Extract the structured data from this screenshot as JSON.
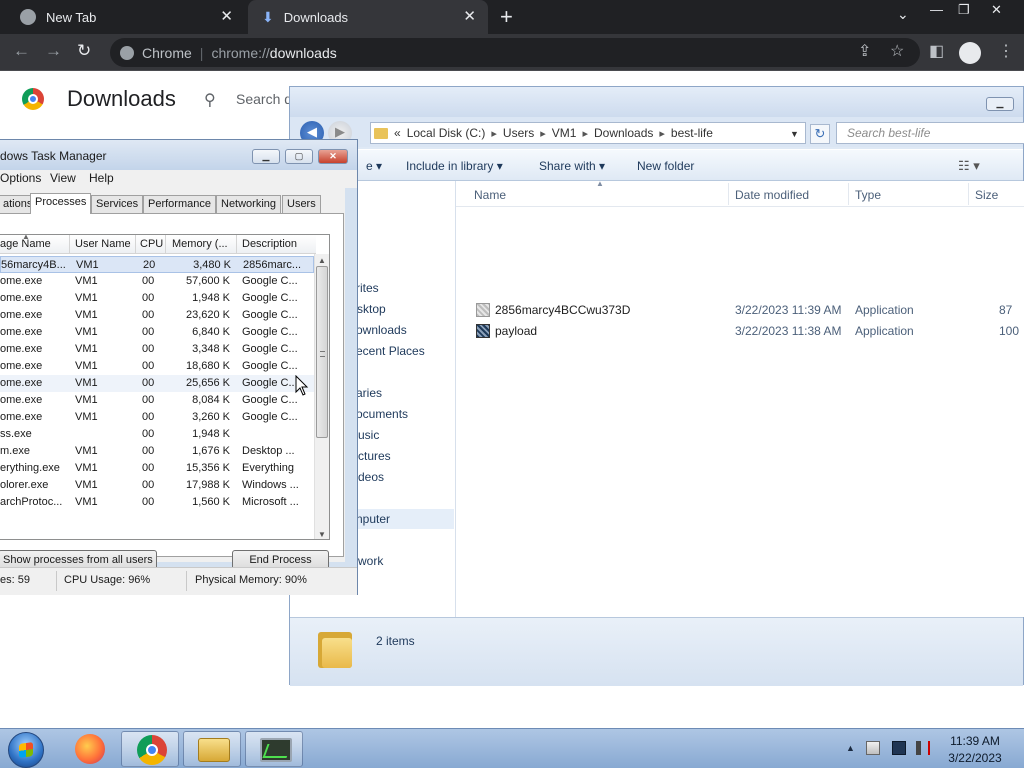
{
  "chrome": {
    "tabs": [
      {
        "title": "New Tab"
      },
      {
        "title": "Downloads"
      }
    ],
    "omnibox": {
      "chip": "Chrome",
      "url_scheme": "chrome://",
      "url_host": "downloads"
    },
    "page": {
      "title": "Downloads",
      "search_placeholder": "Search d"
    }
  },
  "explorer": {
    "address": {
      "prefix": "«",
      "crumbs": [
        "Local Disk (C:)",
        "Users",
        "VM1",
        "Downloads",
        "best-life"
      ]
    },
    "search_placeholder": "Search best-life",
    "commands": {
      "organize_tail": "e",
      "include_in_library": "Include in library",
      "share_with": "Share with",
      "new_folder": "New folder"
    },
    "nav": [
      {
        "label": "rites"
      },
      {
        "label": "sktop"
      },
      {
        "label": "ownloads"
      },
      {
        "label": "ecent Places"
      },
      {
        "label": "aries"
      },
      {
        "label": "ocuments"
      },
      {
        "label": "usic"
      },
      {
        "label": "ctures"
      },
      {
        "label": "deos"
      },
      {
        "label": "nputer"
      },
      {
        "label": "work"
      }
    ],
    "columns": {
      "name": "Name",
      "date_modified": "Date modified",
      "type": "Type",
      "size": "Size"
    },
    "files": [
      {
        "name": "2856marcy4BCCwu373D",
        "date": "3/22/2023 11:39 AM",
        "type": "Application",
        "size": "87"
      },
      {
        "name": "payload",
        "date": "3/22/2023 11:38 AM",
        "type": "Application",
        "size": "100"
      }
    ],
    "details": {
      "item_count": "2 items"
    }
  },
  "task_manager": {
    "title": "dows Task Manager",
    "menu": [
      "Options",
      "View",
      "Help"
    ],
    "tabs": [
      "ations",
      "Processes",
      "Services",
      "Performance",
      "Networking",
      "Users"
    ],
    "active_tab": "Processes",
    "columns": {
      "image_name": "age Name",
      "user_name": "User Name",
      "cpu": "CPU",
      "memory": "Memory (...",
      "description": "Description"
    },
    "processes": [
      {
        "name": "56marcy4B...",
        "user": "VM1",
        "cpu": "20",
        "mem": "3,480 K",
        "desc": "2856marc..."
      },
      {
        "name": "ome.exe",
        "user": "VM1",
        "cpu": "00",
        "mem": "57,600 K",
        "desc": "Google C..."
      },
      {
        "name": "ome.exe",
        "user": "VM1",
        "cpu": "00",
        "mem": "1,948 K",
        "desc": "Google C..."
      },
      {
        "name": "ome.exe",
        "user": "VM1",
        "cpu": "00",
        "mem": "23,620 K",
        "desc": "Google C..."
      },
      {
        "name": "ome.exe",
        "user": "VM1",
        "cpu": "00",
        "mem": "6,840 K",
        "desc": "Google C..."
      },
      {
        "name": "ome.exe",
        "user": "VM1",
        "cpu": "00",
        "mem": "3,348 K",
        "desc": "Google C..."
      },
      {
        "name": "ome.exe",
        "user": "VM1",
        "cpu": "00",
        "mem": "18,680 K",
        "desc": "Google C..."
      },
      {
        "name": "ome.exe",
        "user": "VM1",
        "cpu": "00",
        "mem": "25,656 K",
        "desc": "Google C..."
      },
      {
        "name": "ome.exe",
        "user": "VM1",
        "cpu": "00",
        "mem": "8,084 K",
        "desc": "Google C..."
      },
      {
        "name": "ome.exe",
        "user": "VM1",
        "cpu": "00",
        "mem": "3,260 K",
        "desc": "Google C..."
      },
      {
        "name": "ss.exe",
        "user": "",
        "cpu": "00",
        "mem": "1,948 K",
        "desc": ""
      },
      {
        "name": "m.exe",
        "user": "VM1",
        "cpu": "00",
        "mem": "1,676 K",
        "desc": "Desktop ..."
      },
      {
        "name": "erything.exe",
        "user": "VM1",
        "cpu": "00",
        "mem": "15,356 K",
        "desc": "Everything"
      },
      {
        "name": "olorer.exe",
        "user": "VM1",
        "cpu": "00",
        "mem": "17,988 K",
        "desc": "Windows ..."
      },
      {
        "name": "archProtoc...",
        "user": "VM1",
        "cpu": "00",
        "mem": "1,560 K",
        "desc": "Microsoft ..."
      }
    ],
    "buttons": {
      "show_all": "Show processes from all users",
      "end_process": "End Process"
    },
    "status": {
      "processes": "es: 59",
      "cpu": "CPU Usage: 96%",
      "memory": "Physical Memory: 90%"
    }
  },
  "taskbar": {
    "clock_time": "11:39 AM",
    "clock_date": "3/22/2023"
  }
}
